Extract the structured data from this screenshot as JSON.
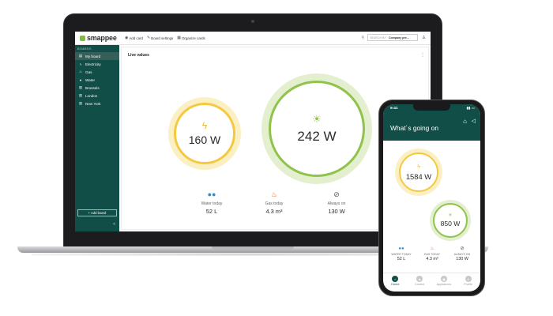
{
  "brand": {
    "name": "smappee",
    "accent": "#104e47",
    "solar": "#8fc34c",
    "electricity": "#f6c840"
  },
  "laptop": {
    "topbar": {
      "actions": [
        {
          "icon": "eye-icon",
          "label": "Add card"
        },
        {
          "icon": "wrench-icon",
          "label": "Board settings"
        },
        {
          "icon": "grid-icon",
          "label": "Organize cards"
        }
      ],
      "search_placeholder": "SEARCH BY",
      "company": "Company pre..."
    },
    "sidebar": {
      "heading": "BOARDS",
      "items": [
        {
          "icon": "board-icon",
          "label": "My board",
          "active": true
        },
        {
          "icon": "lightning-icon",
          "label": "Electricity"
        },
        {
          "icon": "flame-icon",
          "label": "Gas"
        },
        {
          "icon": "water-drop-icon",
          "label": "Water"
        },
        {
          "icon": "bar-chart-icon",
          "label": "Brussels"
        },
        {
          "icon": "bar-chart-icon",
          "label": "London"
        },
        {
          "icon": "bar-chart-icon",
          "label": "New York"
        }
      ],
      "add_board": "+ Add board",
      "collapse": "<"
    },
    "main": {
      "title": "Live values",
      "electricity_value": "160 W",
      "solar_value": "242 W",
      "stats": [
        {
          "icon": "water-drops-icon",
          "label": "Water today",
          "value": "52 L"
        },
        {
          "icon": "flame-icon",
          "label": "Gas today",
          "value": "4.3 m³"
        },
        {
          "icon": "plug-icon",
          "label": "Always on",
          "value": "130 W"
        }
      ]
    }
  },
  "phone": {
    "time": "9:41",
    "title": "What´s going on",
    "electricity_value": "1584 W",
    "solar_value": "850 W",
    "stats": [
      {
        "label": "WATER TODAY",
        "value": "52 L"
      },
      {
        "label": "GAS TODAY",
        "value": "4.3 m³"
      },
      {
        "label": "ALWAYS ON",
        "value": "130 W"
      }
    ],
    "tabs": [
      {
        "label": "Home",
        "active": true
      },
      {
        "label": "Control"
      },
      {
        "label": "Appliances"
      },
      {
        "label": "Profile"
      }
    ]
  }
}
